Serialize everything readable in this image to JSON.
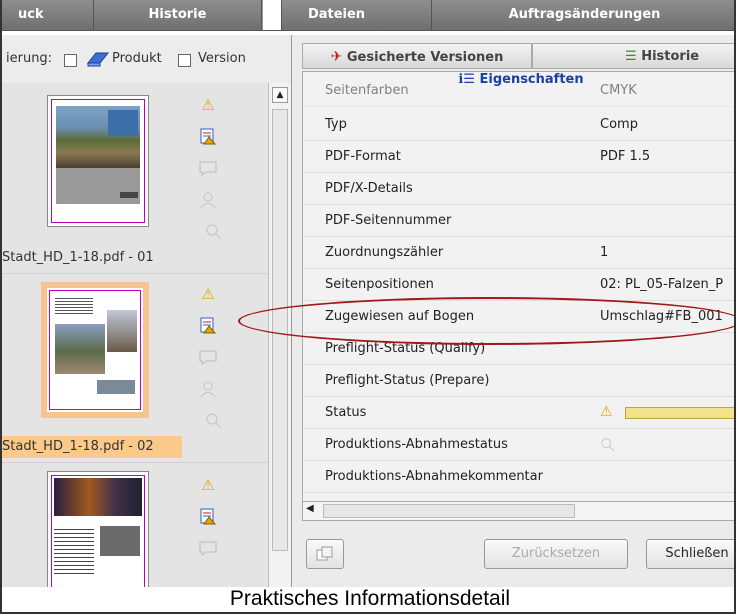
{
  "top_tabs": {
    "t1": "uck",
    "t2": "Historie",
    "t3": "Dateien",
    "t4": "Auftragsänderungen"
  },
  "left_panel": {
    "filter_prefix": "ierung:",
    "filter_produkt": "Produkt",
    "filter_version": "Version",
    "items": [
      {
        "label": "Stadt_HD_1-18.pdf - 01"
      },
      {
        "label": "Stadt_HD_1-18.pdf - 02"
      }
    ]
  },
  "right_panel": {
    "tab_versions": "Gesicherte Versionen",
    "tab_history": "Historie",
    "props_title": "Eigenschaften",
    "rows": [
      {
        "name": "Seitenfarben",
        "value": "CMYK"
      },
      {
        "name": "Typ",
        "value": "Comp"
      },
      {
        "name": "PDF-Format",
        "value": "PDF 1.5"
      },
      {
        "name": "PDF/X-Details",
        "value": ""
      },
      {
        "name": "PDF-Seitennummer",
        "value": ""
      },
      {
        "name": "Zuordnungszähler",
        "value": "1"
      },
      {
        "name": "Seitenpositionen",
        "value": "02: PL_05-Falzen_P"
      },
      {
        "name": "Zugewiesen auf Bogen",
        "value": "Umschlag#FB_001"
      },
      {
        "name": "Preflight-Status (Qualify)",
        "value": ""
      },
      {
        "name": "Preflight-Status (Prepare)",
        "value": ""
      },
      {
        "name": "Status",
        "value": ""
      },
      {
        "name": "Produktions-Abnahmestatus",
        "value": ""
      },
      {
        "name": "Produktions-Abnahmekommentar",
        "value": ""
      }
    ],
    "btn_reset": "Zurücksetzen",
    "btn_close": "Schließen"
  },
  "caption": "Praktisches Informationsdetail",
  "colors": {
    "highlight": "#fbc98a",
    "ellipse": "#a01818",
    "status_bar": "#f2e38a"
  }
}
